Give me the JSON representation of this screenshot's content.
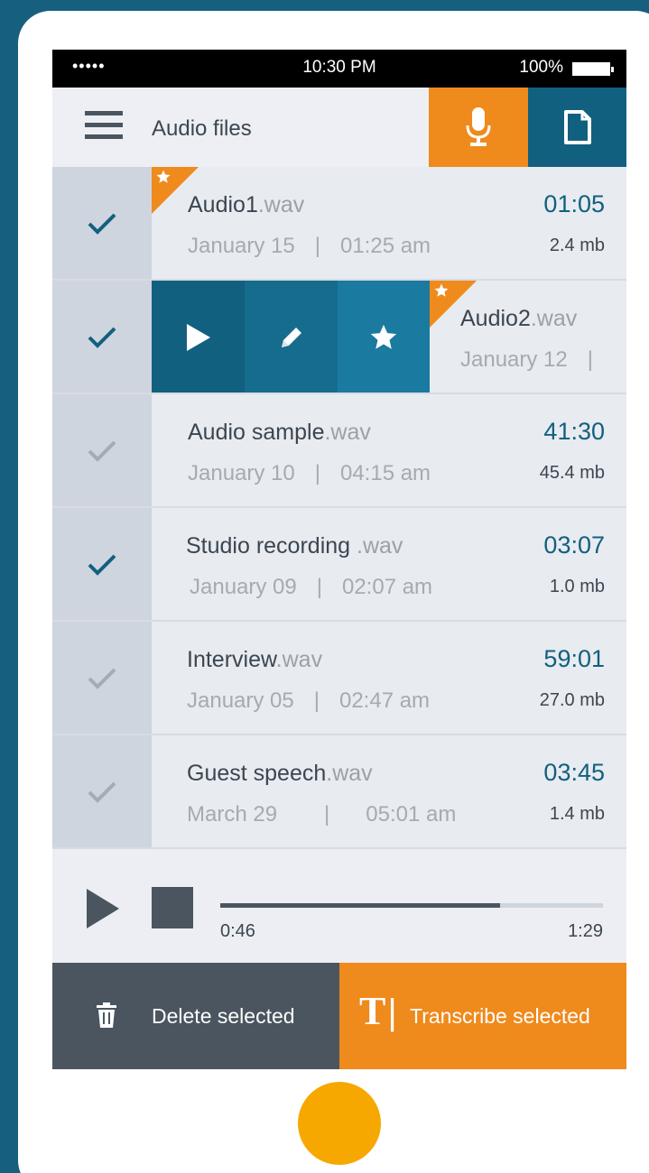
{
  "status_bar": {
    "signal": "•••••",
    "time": "10:30 PM",
    "battery": "100%"
  },
  "app_bar": {
    "title": "Audio files"
  },
  "files": [
    {
      "name": "Audio1",
      "ext": ".wav",
      "date": "January 15",
      "time": "01:25 am",
      "duration": "01:05",
      "size": "2.4 mb",
      "checked": true,
      "starred": true
    },
    {
      "name": "Audio2",
      "ext": ".wav",
      "date": "January 12",
      "time": "",
      "duration": "",
      "size": "",
      "checked": true,
      "starred": true,
      "actions_open": true
    },
    {
      "name": "Audio sample",
      "ext": ".wav",
      "date": "January 10",
      "time": "04:15 am",
      "duration": "41:30",
      "size": "45.4 mb",
      "checked": false,
      "starred": false
    },
    {
      "name": "Studio recording",
      "ext": " .wav",
      "date": "January 09",
      "time": "02:07 am",
      "duration": "03:07",
      "size": "1.0 mb",
      "checked": true,
      "starred": false
    },
    {
      "name": "Interview",
      "ext": ".wav",
      "date": "January 05",
      "time": "02:47 am",
      "duration": "59:01",
      "size": "27.0 mb",
      "checked": false,
      "starred": false
    },
    {
      "name": "Guest speech",
      "ext": ".wav",
      "date": "March 29",
      "time": "05:01 am",
      "duration": "03:45",
      "size": "1.4 mb",
      "checked": false,
      "starred": false
    }
  ],
  "separator": "|",
  "player": {
    "current": "0:46",
    "total": "1:29",
    "progress": 0.73
  },
  "bottom": {
    "delete_label": "Delete selected",
    "transcribe_label": "Transcribe selected",
    "transcribe_icon_glyph": "T"
  },
  "colors": {
    "accent_orange": "#ef8a1c",
    "accent_blue": "#12607f",
    "check_on": "#12607f",
    "check_off": "#a4abb2",
    "home_button": "#f7a800"
  },
  "icons": {
    "menu": "hamburger-icon",
    "mic": "microphone-icon",
    "doc": "document-icon",
    "play": "play-icon",
    "edit": "pencil-icon",
    "star": "star-icon",
    "stop": "stop-icon",
    "delete": "trash-icon",
    "transcribe": "text-cursor-icon"
  }
}
